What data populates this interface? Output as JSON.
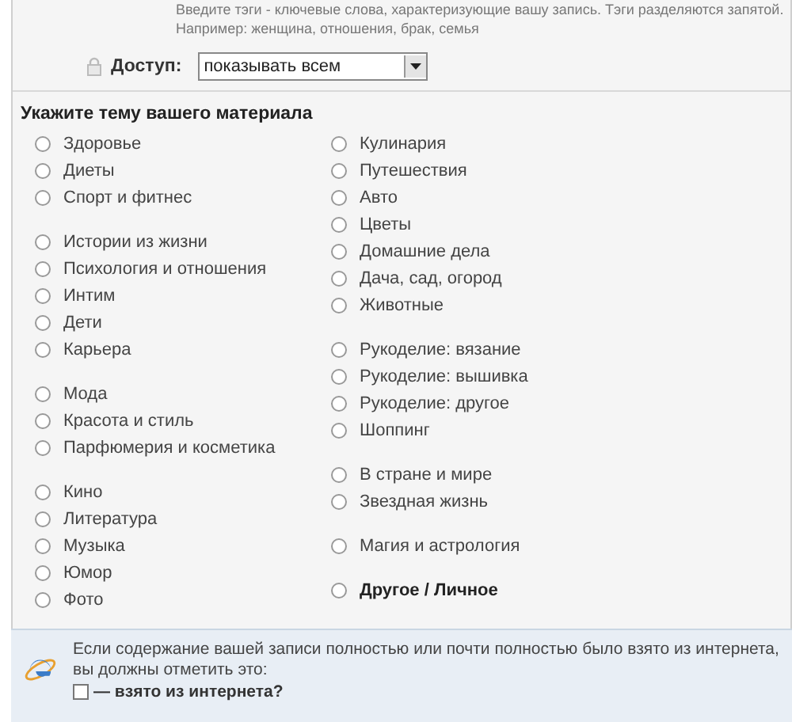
{
  "tags_hint": {
    "lines": [
      "Введите тэги - ключевые слова, характеризующие вашу запись. Тэги разделяются запятой.",
      "Например: женщина, отношения, брак, семья"
    ]
  },
  "access": {
    "label": "Доступ:",
    "value": "показывать всем"
  },
  "topic": {
    "heading": "Укажите тему вашего материала",
    "columns": [
      [
        [
          {
            "label": "Здоровье",
            "selected": false,
            "kind": "plain"
          },
          {
            "label": "Диеты",
            "selected": false,
            "kind": "plain"
          },
          {
            "label": "Спорт и фитнес",
            "selected": false,
            "kind": "plain"
          }
        ],
        [
          {
            "label": "Истории из жизни",
            "selected": false,
            "kind": "plain"
          },
          {
            "label": "Психология и отношения",
            "selected": false,
            "kind": "plain"
          },
          {
            "label": "Интим",
            "selected": false,
            "kind": "plain"
          },
          {
            "label": "Дети",
            "selected": false,
            "kind": "plain"
          },
          {
            "label": "Карьера",
            "selected": false,
            "kind": "plain"
          }
        ],
        [
          {
            "label": "Мода",
            "selected": false,
            "kind": "plain"
          },
          {
            "label": "Красота и стиль",
            "selected": false,
            "kind": "plain"
          },
          {
            "label": "Парфюмерия и косметика",
            "selected": false,
            "kind": "plain"
          }
        ],
        [
          {
            "label": "Кино",
            "selected": false,
            "kind": "plain"
          },
          {
            "label": "Литература",
            "selected": false,
            "kind": "plain"
          },
          {
            "label": "Музыка",
            "selected": false,
            "kind": "plain"
          },
          {
            "label": "Юмор",
            "selected": false,
            "kind": "plain"
          },
          {
            "label": "Фото",
            "selected": false,
            "kind": "plain"
          }
        ]
      ],
      [
        [
          {
            "label": "Кулинария",
            "selected": false,
            "kind": "plain"
          },
          {
            "label": "Путешествия",
            "selected": false,
            "kind": "plain"
          },
          {
            "label": "Авто",
            "selected": false,
            "kind": "plain"
          },
          {
            "label": "Цветы",
            "selected": false,
            "kind": "plain"
          },
          {
            "label": "Домашние дела",
            "selected": false,
            "kind": "plain"
          },
          {
            "label": "Дача, сад, огород",
            "selected": false,
            "kind": "plain"
          },
          {
            "label": "Животные",
            "selected": false,
            "kind": "plain"
          }
        ],
        [
          {
            "label": "Рукоделие: вязание",
            "selected": false,
            "kind": "plain"
          },
          {
            "label": "Рукоделие: вышивка",
            "selected": false,
            "kind": "plain"
          },
          {
            "label": "Рукоделие: другое",
            "selected": false,
            "kind": "plain"
          },
          {
            "label": "Шоппинг",
            "selected": false,
            "kind": "plain"
          }
        ],
        [
          {
            "label": "В стране и мире",
            "selected": false,
            "kind": "plain"
          },
          {
            "label": "Звездная жизнь",
            "selected": false,
            "kind": "plain"
          }
        ],
        [
          {
            "label": "Магия и астрология",
            "selected": false,
            "kind": "plain"
          }
        ],
        [
          {
            "label": "Другое / Личное",
            "selected": false,
            "kind": "bold"
          }
        ]
      ]
    ]
  },
  "notice": {
    "text": "Если содержание вашей записи полностью или почти полностью было взято из интернета, вы должны отметить это:",
    "checkbox": {
      "label": "— взято из интернета?",
      "checked": false
    }
  }
}
